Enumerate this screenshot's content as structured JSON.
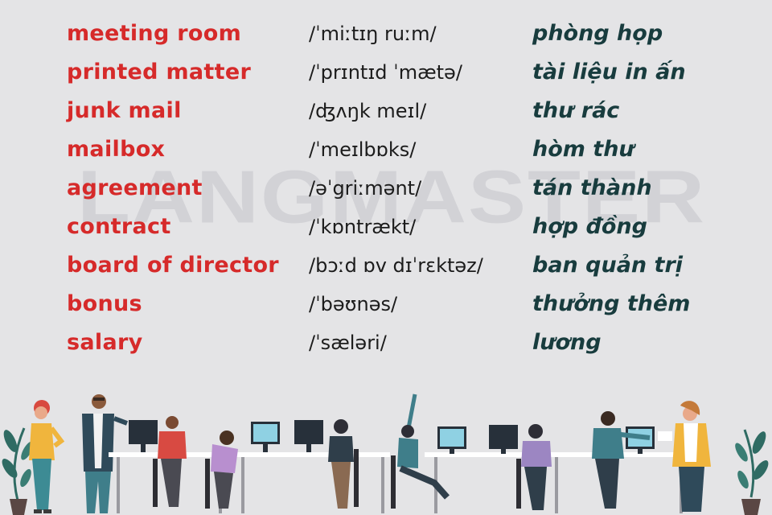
{
  "watermark": "LANGMASTER",
  "vocabulary": [
    {
      "word": "meeting room",
      "ipa": "/ˈmiːtɪŋ ruːm/",
      "meaning": "phòng họp"
    },
    {
      "word": "printed matter",
      "ipa": "/ˈprɪntɪd ˈmætə/",
      "meaning": "tài liệu in ấn"
    },
    {
      "word": "junk mail",
      "ipa": "/ʤʌŋk meɪl/",
      "meaning": "thư rác"
    },
    {
      "word": "mailbox",
      "ipa": "/ˈmeɪlbɒks/",
      "meaning": "hòm thư"
    },
    {
      "word": "agreement",
      "ipa": "/əˈgriːmənt/",
      "meaning": "tán thành"
    },
    {
      "word": "contract",
      "ipa": "/ˈkɒntrækt/",
      "meaning": "hợp đồng"
    },
    {
      "word": "board of director",
      "ipa": "/bɔːd ɒv dɪˈrɛktəz/",
      "meaning": "ban quản trị"
    },
    {
      "word": "bonus",
      "ipa": "/ˈbəʊnəs/",
      "meaning": "thưởng thêm"
    },
    {
      "word": "salary",
      "ipa": "/ˈsæləri/",
      "meaning": "lương"
    }
  ],
  "colors": {
    "background": "#e4e4e6",
    "word": "#d62a2a",
    "ipa": "#1c1c1c",
    "meaning": "#183c3e",
    "watermark": "#d2d2d6"
  },
  "illustration": {
    "subject": "office-workers-at-desks-illustration"
  }
}
